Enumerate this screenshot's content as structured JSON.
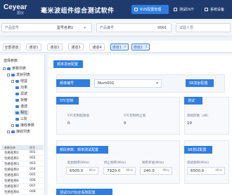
{
  "header": {
    "logo": "Ceyear",
    "logo_sub": "思仪",
    "title": "毫米波组件综合测试软件",
    "buttons": [
      {
        "label": "RUS配置管理",
        "icon": "settings-icon"
      },
      {
        "label": "测试DUT",
        "icon": "chip-icon"
      },
      {
        "label": "系统设备",
        "icon": "device-icon"
      }
    ]
  },
  "info": {
    "product_model_label": "产品型号",
    "product_model_value": "型号名称1",
    "product_no_label": "产品编号",
    "product_no_value": "0001",
    "tester_label": "试验人员"
  },
  "channels": [
    "全部通道",
    "通道1",
    "通道2",
    "通道3",
    "通道4",
    "通道1",
    "通道2"
  ],
  "left": {
    "title": "选择参数",
    "tree": [
      "参数列表",
      "发射列表",
      "增益",
      "功率",
      "滤波",
      "杂散",
      "谐波",
      "相位",
      "三阶",
      "接收参数",
      "接收列表"
    ],
    "table_head": [
      "参数名称",
      "序号"
    ],
    "table_rows": [
      {
        "name": "包络名称1",
        "no": "001"
      },
      {
        "name": "包络名称2",
        "no": "002"
      },
      {
        "name": "包络名称3",
        "no": "003"
      },
      {
        "name": "包络名称4",
        "no": "004"
      },
      {
        "name": "包络名称5",
        "no": "005"
      },
      {
        "name": "包络名称6",
        "no": "006"
      },
      {
        "name": "包络名称7",
        "no": "007"
      },
      {
        "name": "包络名称8",
        "no": "008"
      }
    ]
  },
  "main": {
    "section_title": "频率发射配置",
    "sub_label": "频率编号",
    "sub_value": "Num001",
    "right_label": "SB发射配置",
    "stc_label": "STC控制",
    "stc_field1_label": "STC控制起始值",
    "stc_field1_value": "0",
    "stc_field2_label": "STC控制终止值",
    "stc_field2_value": "0",
    "right_field_label": "衰耗阶数（dB）",
    "right_field_value": "10",
    "right_box2_label": "测试",
    "freq_label": "频段参数、频率测试配置",
    "freq_right_label": "SB测试配置",
    "start_label": "起始频率(MHz)",
    "start_value": "6500.0",
    "stop_label": "终止频率(MHz)",
    "stop_value": "7920.0",
    "step_label": "频率步进(MHz)",
    "step_value": "240.0",
    "right_freq_label": "测试频率(MHz)",
    "right_freq_value": "6500.0",
    "unit_mhz": "MHz",
    "bottom_label": "测试DUT标定系数配置"
  },
  "colors": {
    "topbar": "#1f3b6e",
    "accent": "#2f7de1"
  }
}
